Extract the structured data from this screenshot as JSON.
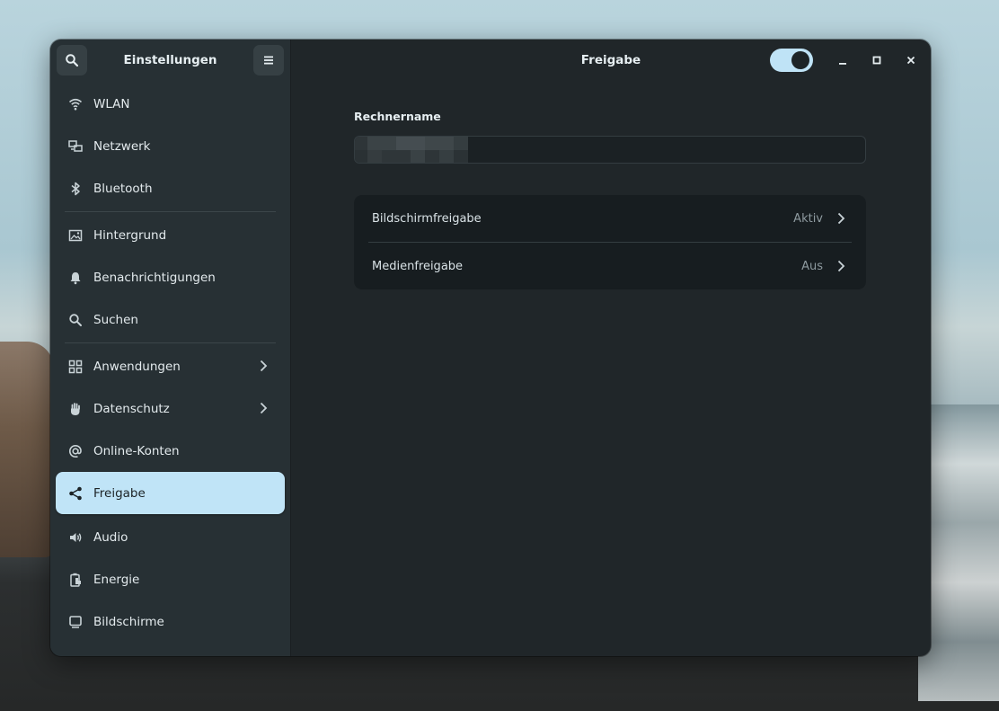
{
  "sidebar": {
    "title": "Einstellungen",
    "items": [
      {
        "label": "WLAN",
        "icon": "wifi-icon"
      },
      {
        "label": "Netzwerk",
        "icon": "network-icon"
      },
      {
        "label": "Bluetooth",
        "icon": "bluetooth-icon"
      },
      {
        "label": "Hintergrund",
        "icon": "image-icon"
      },
      {
        "label": "Benachrichtigungen",
        "icon": "bell-icon"
      },
      {
        "label": "Suchen",
        "icon": "search-icon"
      },
      {
        "label": "Anwendungen",
        "icon": "apps-grid-icon"
      },
      {
        "label": "Datenschutz",
        "icon": "hand-icon"
      },
      {
        "label": "Online-Konten",
        "icon": "at-icon"
      },
      {
        "label": "Freigabe",
        "icon": "share-icon"
      },
      {
        "label": "Audio",
        "icon": "speaker-icon"
      },
      {
        "label": "Energie",
        "icon": "battery-icon"
      },
      {
        "label": "Bildschirme",
        "icon": "monitor-icon"
      }
    ],
    "active": "Freigabe"
  },
  "header": {
    "title": "Freigabe",
    "sharing_toggle_on": true
  },
  "main": {
    "hostname_label": "Rechnername",
    "hostname_value_redacted": true,
    "rows": [
      {
        "label": "Bildschirmfreigabe",
        "status": "Aktiv"
      },
      {
        "label": "Medienfreigabe",
        "status": "Aus"
      }
    ]
  },
  "colors": {
    "accent": "#c0e4f7",
    "window_bg": "#202629",
    "sidebar_bg": "#273034"
  }
}
